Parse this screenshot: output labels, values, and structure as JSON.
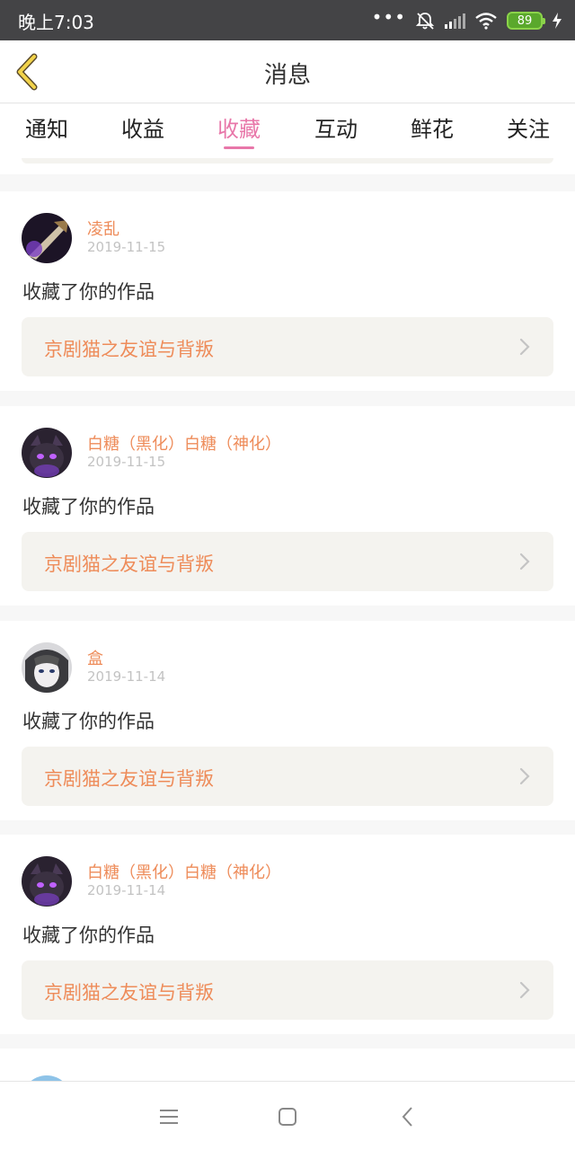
{
  "status_bar": {
    "time": "晚上7:03",
    "dots": "•••",
    "battery": "89"
  },
  "header": {
    "title": "消息"
  },
  "tabs": [
    {
      "label": "通知"
    },
    {
      "label": "收益"
    },
    {
      "label": "收藏"
    },
    {
      "label": "互动"
    },
    {
      "label": "鲜花"
    },
    {
      "label": "关注"
    }
  ],
  "active_tab": "收藏",
  "messages": [
    {
      "username": "凌乱",
      "date": "2019-11-15",
      "action": "收藏了你的作品",
      "work_title": "京剧猫之友谊与背叛"
    },
    {
      "username": "白糖（黑化）白糖（神化）",
      "date": "2019-11-15",
      "action": "收藏了你的作品",
      "work_title": "京剧猫之友谊与背叛"
    },
    {
      "username": "盒",
      "date": "2019-11-14",
      "action": "收藏了你的作品",
      "work_title": "京剧猫之友谊与背叛"
    },
    {
      "username": "白糖（黑化）白糖（神化）",
      "date": "2019-11-14",
      "action": "收藏了你的作品",
      "work_title": "京剧猫之友谊与背叛"
    }
  ],
  "colors": {
    "accent": "#e877a9",
    "name": "#ee8c5a"
  },
  "icons": {
    "back": "chevron-left-icon",
    "menu": "menu-icon",
    "home": "home-icon",
    "nav_back": "back-icon"
  }
}
